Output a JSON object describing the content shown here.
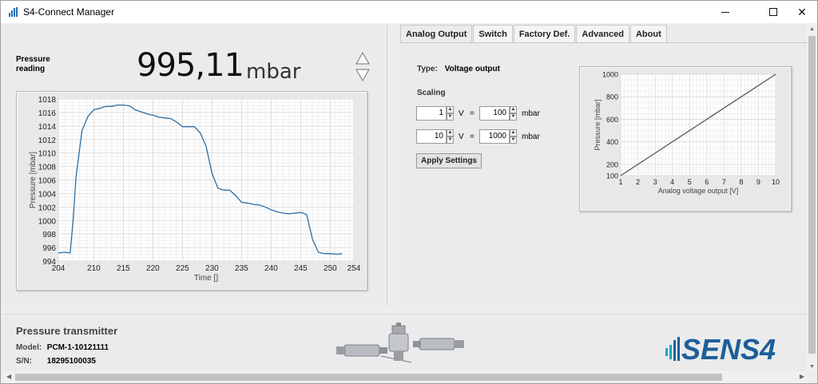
{
  "window": {
    "title": "S4-Connect Manager",
    "icons": {
      "app": "signal-bars-icon",
      "minimize": "minimize-icon",
      "maximize": "maximize-icon",
      "close": "close-icon"
    },
    "close_glyph": "✕"
  },
  "reading": {
    "label_line1": "Pressure",
    "label_line2": "reading",
    "value": "995,11",
    "unit": "mbar"
  },
  "tabs": [
    {
      "label": "Analog Output",
      "active": true
    },
    {
      "label": "Switch",
      "active": false
    },
    {
      "label": "Factory Def.",
      "active": false
    },
    {
      "label": "Advanced",
      "active": false
    },
    {
      "label": "About",
      "active": false
    }
  ],
  "analog": {
    "type_key": "Type:",
    "type_value": "Voltage output",
    "scaling_label": "Scaling",
    "rows": [
      {
        "voltage": "1",
        "v_unit": "V",
        "eq": "=",
        "pressure": "100",
        "p_unit": "mbar"
      },
      {
        "voltage": "10",
        "v_unit": "V",
        "eq": "=",
        "pressure": "1000",
        "p_unit": "mbar"
      }
    ],
    "apply_label": "Apply Settings"
  },
  "footer": {
    "title": "Pressure transmitter",
    "model_key": "Model:",
    "model_value": "PCM-1-10121111",
    "sn_key": "S/N:",
    "sn_value": "18295100035",
    "logo_text": "SENS4"
  },
  "colors": {
    "accent": "#1f6fb5",
    "line": "#2a6ea6",
    "logo_blue": "#1c5e9b",
    "logo_teal": "#1fa3c4"
  },
  "chart_data": [
    {
      "type": "line",
      "xlabel": "Time []",
      "ylabel": "Pressure [mbar]",
      "xlim": [
        204,
        254
      ],
      "ylim": [
        994,
        1018
      ],
      "xticks": [
        204,
        210,
        215,
        220,
        225,
        230,
        235,
        240,
        245,
        250,
        254
      ],
      "yticks": [
        994,
        996,
        998,
        1000,
        1002,
        1004,
        1006,
        1008,
        1010,
        1012,
        1014,
        1016,
        1018
      ],
      "grid": true,
      "x": [
        204,
        205,
        206,
        206.5,
        207,
        208,
        209,
        210,
        211,
        212,
        213,
        214,
        215,
        216,
        217,
        218,
        219,
        220,
        221,
        222,
        223,
        224,
        225,
        226,
        227,
        228,
        229,
        230,
        231,
        232,
        233,
        234,
        235,
        236,
        237,
        238,
        239,
        240,
        241,
        242,
        243,
        244,
        245,
        246,
        247,
        248,
        249,
        250,
        251,
        252
      ],
      "y": [
        995.2,
        995.3,
        995.2,
        1000,
        1006.5,
        1013.3,
        1015.4,
        1016.4,
        1016.6,
        1016.9,
        1016.9,
        1017.1,
        1017.1,
        1017.0,
        1016.4,
        1016.1,
        1015.8,
        1015.6,
        1015.3,
        1015.2,
        1015.1,
        1014.6,
        1013.9,
        1013.9,
        1013.9,
        1013.0,
        1011.0,
        1007.0,
        1004.8,
        1004.5,
        1004.5,
        1003.7,
        1002.7,
        1002.6,
        1002.4,
        1002.3,
        1002.0,
        1001.6,
        1001.3,
        1001.1,
        1001.0,
        1001.1,
        1001.2,
        1000.9,
        997.2,
        995.3,
        995.1,
        995.1,
        995.0,
        995.1
      ]
    },
    {
      "type": "line",
      "xlabel": "Analog voltage output  [V]",
      "ylabel": "Pressure [mbar]",
      "xlim": [
        1,
        10
      ],
      "ylim": [
        100,
        1000
      ],
      "xticks": [
        1,
        2,
        3,
        4,
        5,
        6,
        7,
        8,
        9,
        10
      ],
      "yticks": [
        100,
        200,
        400,
        600,
        800,
        1000
      ],
      "grid": true,
      "x": [
        1,
        10
      ],
      "y": [
        100,
        1000
      ]
    }
  ]
}
